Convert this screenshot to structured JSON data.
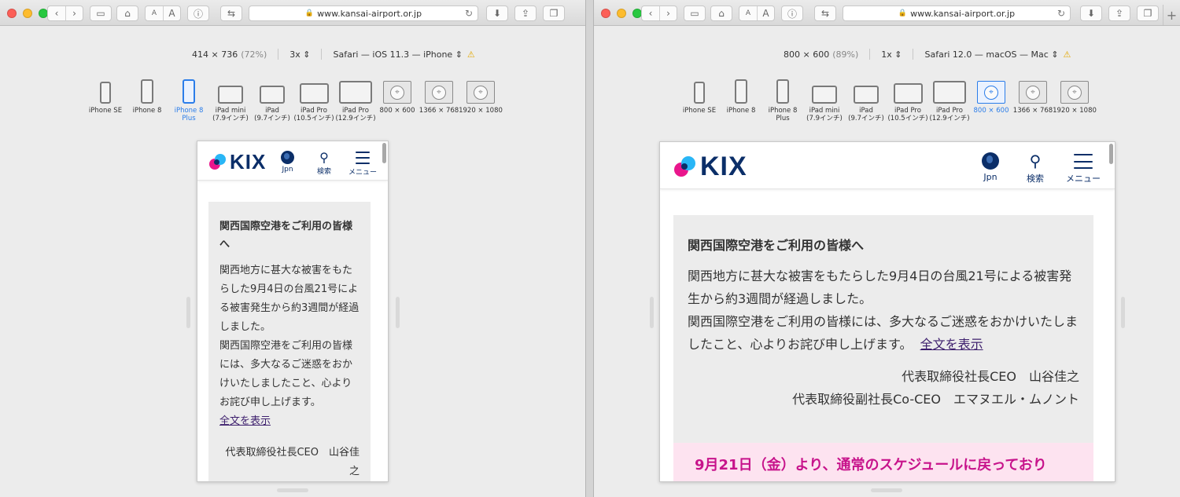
{
  "browser": {
    "url": "www.kansai-airport.or.jp",
    "new_tab": "+"
  },
  "colors": {
    "selected": "#2b7de9",
    "kix_navy": "#0b2e68",
    "notice_bg": "#ececec",
    "pink": "#c7138b",
    "pink_bg": "#fde3f0",
    "link": "#3d1f6d"
  },
  "left": {
    "rdm": {
      "size": "414 × 736",
      "zoom": "(72%)",
      "scale": "3x",
      "agent": "Safari — iOS 11.3 — iPhone"
    }
  },
  "right": {
    "rdm": {
      "size": "800 × 600",
      "zoom": "(89%)",
      "scale": "1x",
      "agent": "Safari 12.0 — macOS — Mac"
    }
  },
  "devices": [
    {
      "label": "iPhone SE",
      "label2": ""
    },
    {
      "label": "iPhone 8",
      "label2": ""
    },
    {
      "label": "iPhone 8",
      "label2": "Plus"
    },
    {
      "label": "iPad mini",
      "label2": "(7.9インチ)"
    },
    {
      "label": "iPad",
      "label2": "(9.7インチ)"
    },
    {
      "label": "iPad Pro",
      "label2": "(10.5インチ)"
    },
    {
      "label": "iPad Pro",
      "label2": "(12.9インチ)"
    },
    {
      "label": "800 × 600",
      "label2": ""
    },
    {
      "label": "1366 × 768",
      "label2": ""
    },
    {
      "label": "1920 × 1080",
      "label2": ""
    }
  ],
  "site": {
    "logo": "KIX",
    "lang_label": "Jpn",
    "search_label": "検索",
    "menu_label": "メニュー",
    "notice_title": "関西国際空港をご利用の皆様へ",
    "body_p1": "関西地方に甚大な被害をもたらした9月4日の台風21号による被害発生から約3週間が経過しました。",
    "body_p2": "関西国際空港をご利用の皆様には、多大なるご迷惑をおかけいたしましたこと、心よりお詫び申し上げます。",
    "read_more": "全文を表示",
    "sign1": "代表取締役社長CEO　山谷佳之",
    "sign2": "代表取締役副社長Co-CEO　エマヌエル・ムノント",
    "banner": "9月21日（金）より、通常のスケジュールに戻っており"
  }
}
